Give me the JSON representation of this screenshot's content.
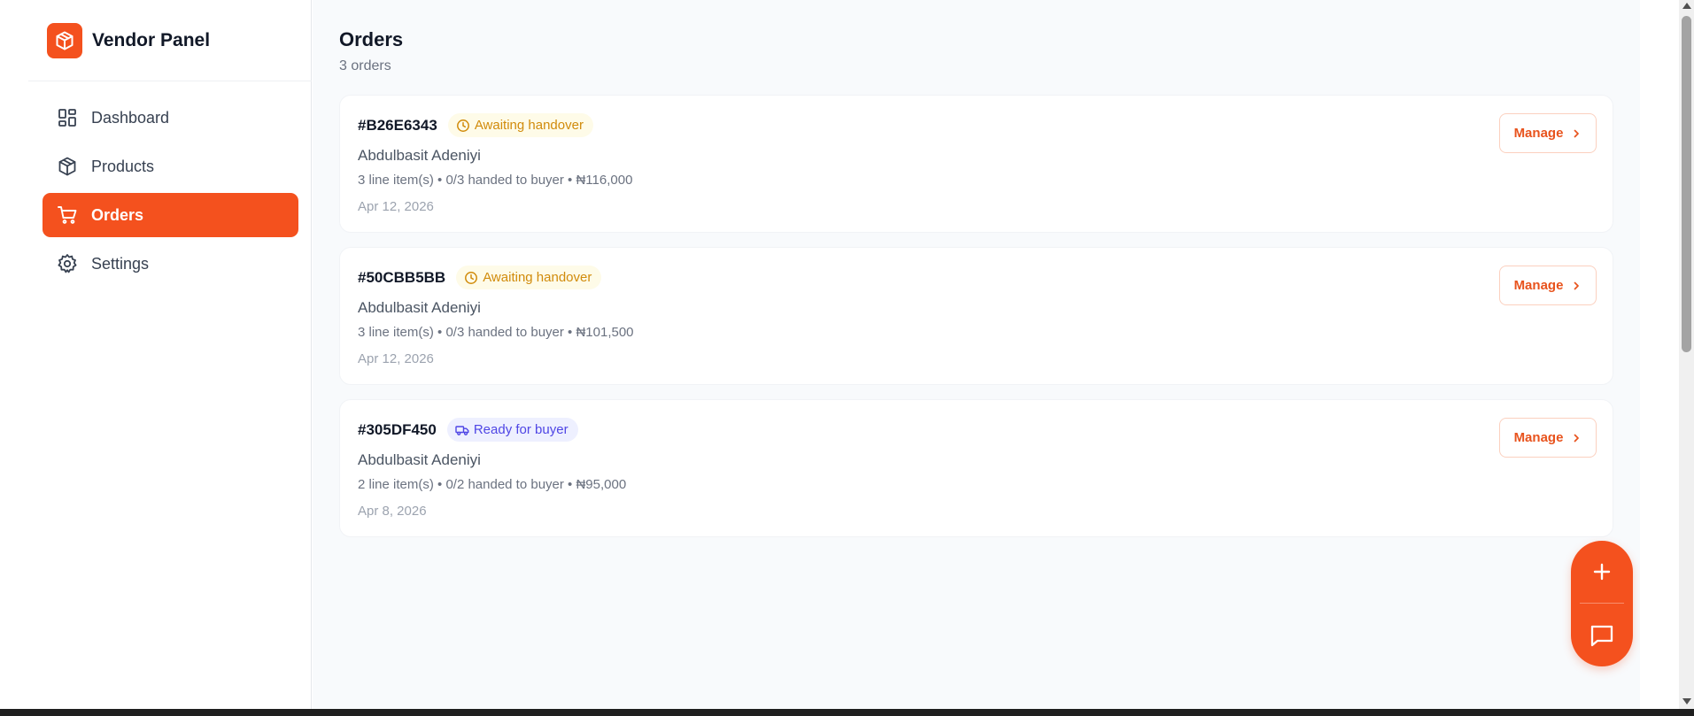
{
  "app": {
    "name": "Vendor Panel",
    "logo_icon": "box-icon",
    "accent": "#f4511e"
  },
  "sidebar": {
    "items": [
      {
        "label": "Dashboard",
        "icon": "dashboard-grid-icon",
        "active": false
      },
      {
        "label": "Products",
        "icon": "box-icon",
        "active": false
      },
      {
        "label": "Orders",
        "icon": "cart-icon",
        "active": true
      },
      {
        "label": "Settings",
        "icon": "gear-icon",
        "active": false
      }
    ]
  },
  "main": {
    "title": "Orders",
    "subtitle": "3 orders"
  },
  "orders": [
    {
      "id": "#B26E6343",
      "status": "Awaiting handover",
      "status_icon": "clock-icon",
      "status_color": "#d18b0b",
      "buyer": "Abdulbasit Adeniyi",
      "meta": "3 line item(s) • 0/3 handed to buyer • ₦116,000",
      "date": "Apr 12, 2026",
      "action": "Manage"
    },
    {
      "id": "#50CBB5BB",
      "status": "Awaiting handover",
      "status_icon": "clock-icon",
      "status_color": "#d18b0b",
      "buyer": "Abdulbasit Adeniyi",
      "meta": "3 line item(s) • 0/3 handed to buyer • ₦101,500",
      "date": "Apr 12, 2026",
      "action": "Manage"
    },
    {
      "id": "#305DF450",
      "status": "Ready for buyer",
      "status_icon": "truck-icon",
      "status_color": "#4f46e5",
      "buyer": "Abdulbasit Adeniyi",
      "meta": "2 line item(s) • 0/2 handed to buyer • ₦95,000",
      "date": "Apr 8, 2026",
      "action": "Manage"
    }
  ],
  "fab": {
    "top_icon": "plus-icon",
    "bottom_icon": "chat-icon"
  }
}
